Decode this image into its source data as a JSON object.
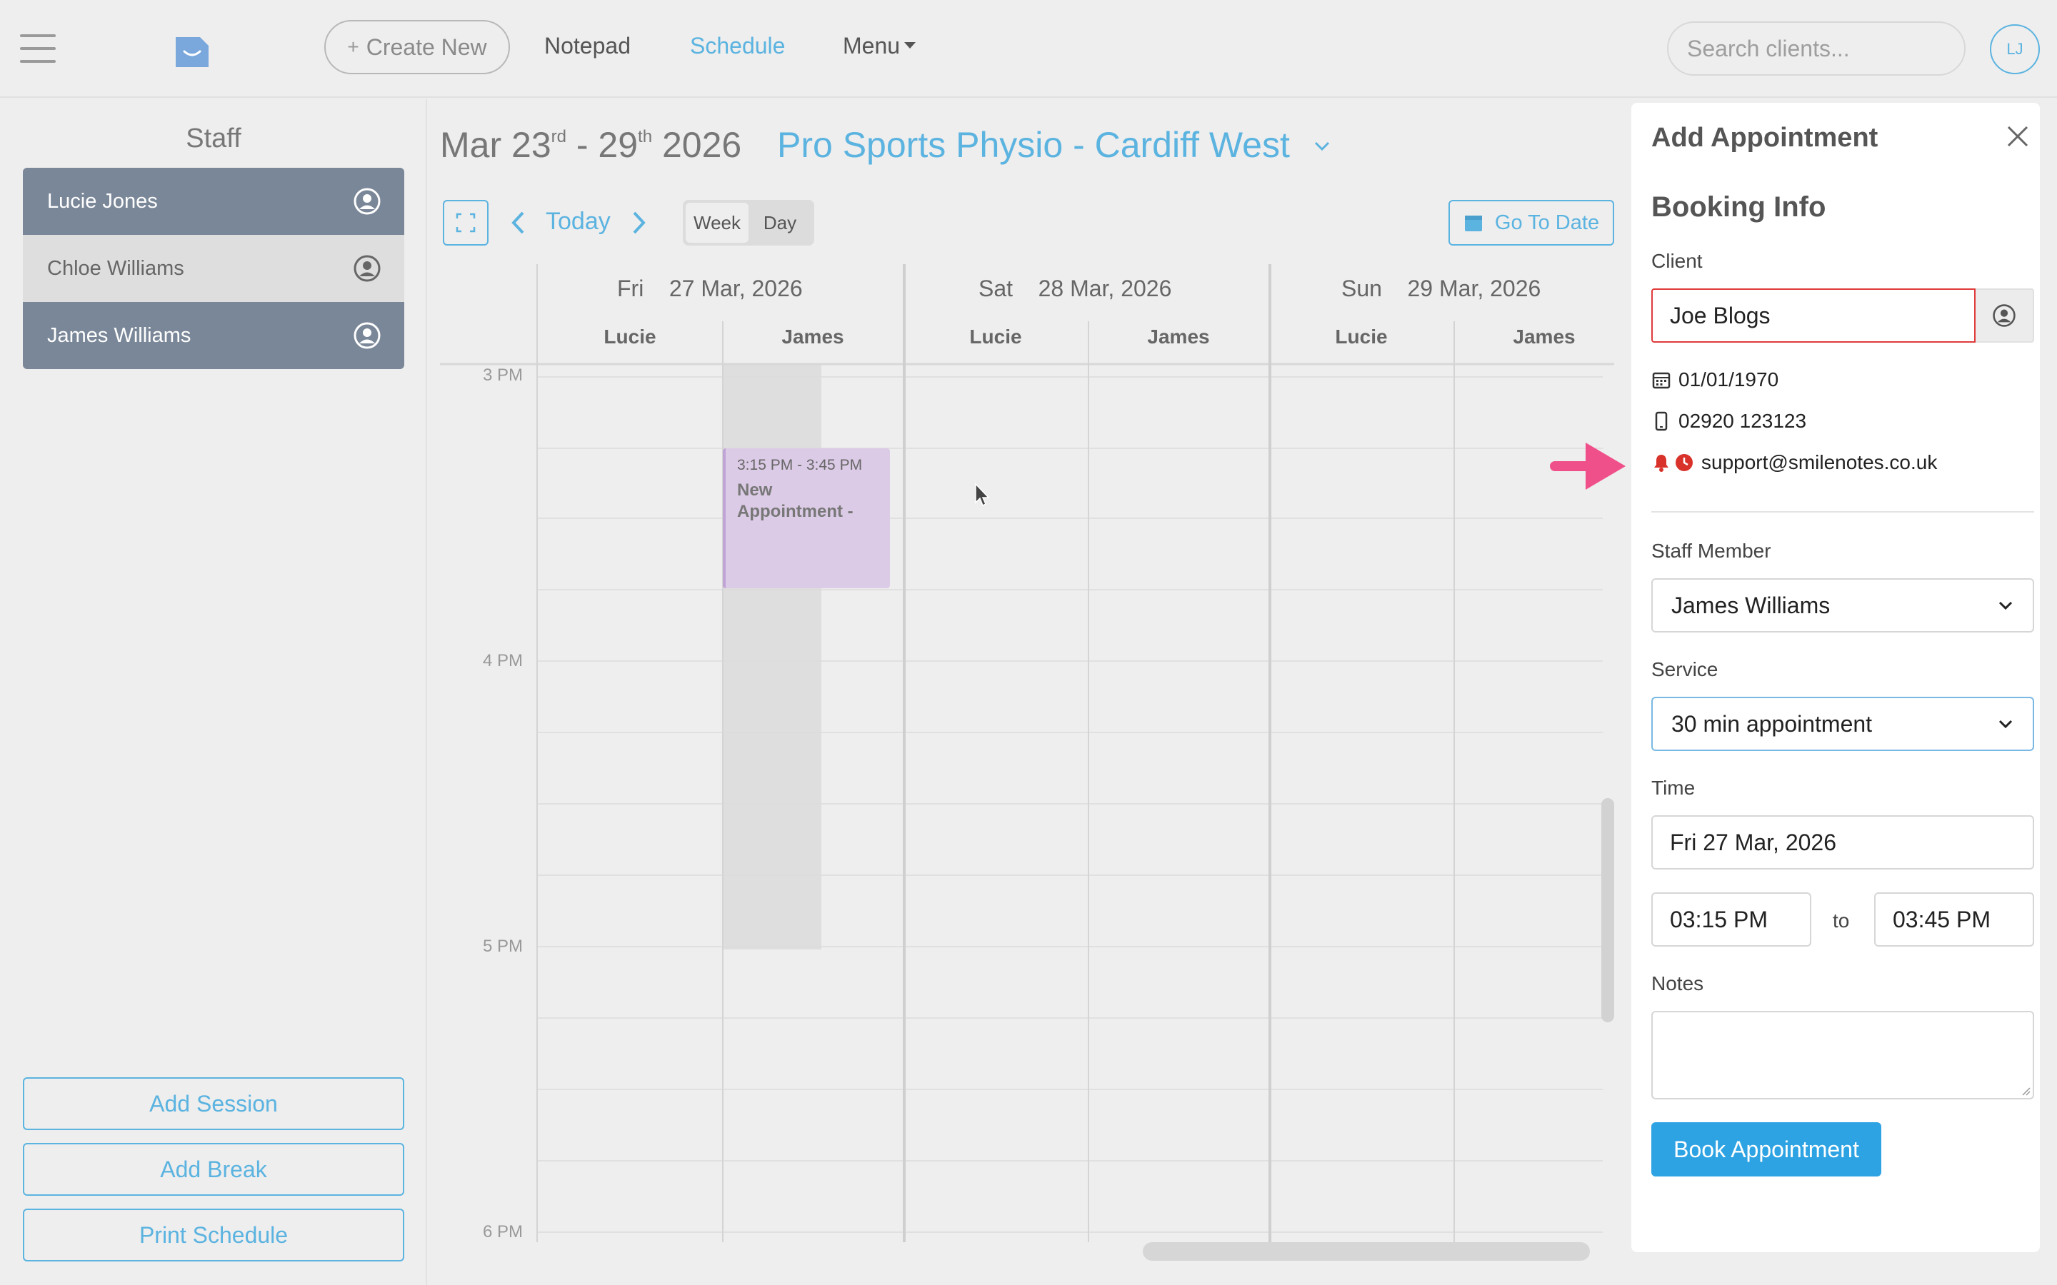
{
  "topbar": {
    "create_new": "Create New",
    "nav": {
      "notepad": "Notepad",
      "schedule": "Schedule",
      "menu": "Menu"
    },
    "search_placeholder": "Search clients...",
    "avatar_initials": "LJ"
  },
  "sidebar": {
    "title": "Staff",
    "staff": [
      {
        "name": "Lucie Jones",
        "selected": true
      },
      {
        "name": "Chloe Williams",
        "selected": false
      },
      {
        "name": "James Williams",
        "selected": true
      }
    ],
    "buttons": {
      "add_session": "Add Session",
      "add_break": "Add Break",
      "print_schedule": "Print Schedule"
    }
  },
  "calendar": {
    "range": {
      "start_month": "Mar",
      "start_day": "23",
      "start_suffix": "rd",
      "end_day": "29",
      "end_suffix": "th",
      "year": "2026"
    },
    "location": "Pro Sports Physio - Cardiff West",
    "today": "Today",
    "view": {
      "week": "Week",
      "day": "Day",
      "active": "Week"
    },
    "go_to_date": "Go To Date",
    "days": [
      {
        "dow": "Fri",
        "date": "27 Mar, 2026",
        "staff": [
          "Lucie",
          "James"
        ]
      },
      {
        "dow": "Sat",
        "date": "28 Mar, 2026",
        "staff": [
          "Lucie",
          "James"
        ]
      },
      {
        "dow": "Sun",
        "date": "29 Mar, 2026",
        "staff": [
          "Lucie",
          "James"
        ]
      }
    ],
    "times": [
      "3 PM",
      "4 PM",
      "5 PM",
      "6 PM"
    ],
    "appointment": {
      "time": "3:15 PM - 3:45 PM",
      "title": "New Appointment -"
    }
  },
  "panel": {
    "title": "Add Appointment",
    "section": "Booking Info",
    "client_label": "Client",
    "client_value": "Joe Blogs",
    "dob": "01/01/1970",
    "phone": "02920 123123",
    "email": "support@smilenotes.co.uk",
    "staff_label": "Staff Member",
    "staff_value": "James Williams",
    "service_label": "Service",
    "service_value": "30 min appointment",
    "time_label": "Time",
    "date_value": "Fri 27 Mar, 2026",
    "start_time": "03:15 PM",
    "to": "to",
    "end_time": "03:45 PM",
    "notes_label": "Notes",
    "book_button": "Book Appointment"
  },
  "colors": {
    "accent": "#5bb3e0",
    "book_button": "#2ea3e3",
    "staff_selected": "#7a8798",
    "appointment": "#dccbe6",
    "client_error_border": "#e03a3a",
    "annotation_arrow": "#f0508a"
  },
  "icons": {
    "menu": "hamburger-icon",
    "logo": "app-logo-icon",
    "staff": "user-circle-icon",
    "calendar": "calendar-icon",
    "phone": "mobile-phone-icon",
    "bell": "bell-icon",
    "clock": "clock-icon",
    "close": "close-icon",
    "annotation": "arrow-right-icon"
  }
}
